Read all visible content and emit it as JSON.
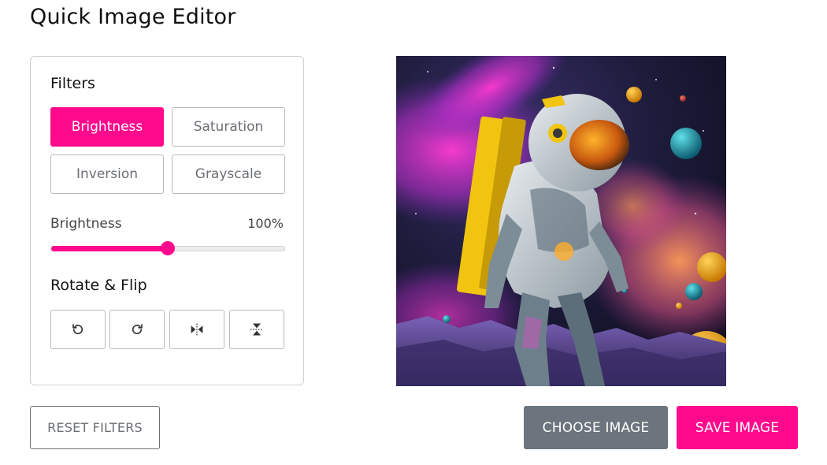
{
  "app": {
    "title": "Quick Image Editor"
  },
  "filters": {
    "heading": "Filters",
    "options": [
      {
        "label": "Brightness",
        "active": true
      },
      {
        "label": "Saturation",
        "active": false
      },
      {
        "label": "Inversion",
        "active": false
      },
      {
        "label": "Grayscale",
        "active": false
      }
    ]
  },
  "slider": {
    "label": "Brightness",
    "value_text": "100%",
    "fraction": 0.5
  },
  "rotate": {
    "heading": "Rotate & Flip",
    "buttons": [
      {
        "icon": "rotate-left-icon"
      },
      {
        "icon": "rotate-right-icon"
      },
      {
        "icon": "flip-horizontal-icon"
      },
      {
        "icon": "flip-vertical-icon"
      }
    ]
  },
  "preview": {
    "subject": "astronaut-illustration"
  },
  "actions": {
    "reset_label": "RESET FILTERS",
    "choose_label": "CHOOSE IMAGE",
    "save_label": "SAVE IMAGE"
  },
  "colors": {
    "accent": "#ff0a8d",
    "secondary": "#6c757d",
    "border": "#cfcfcf"
  }
}
